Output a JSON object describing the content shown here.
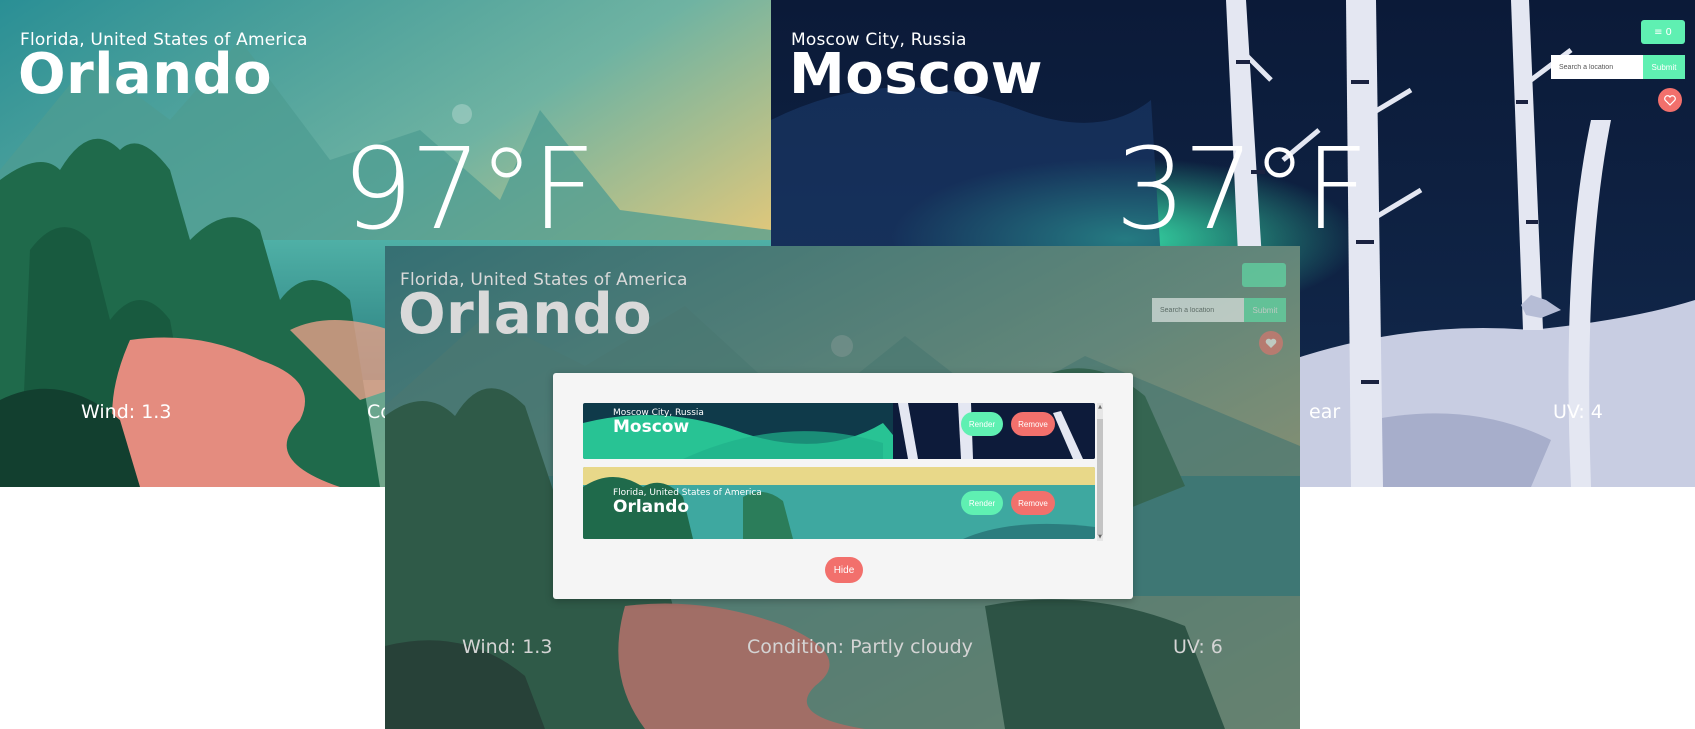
{
  "orlando_bg": {
    "region": "Florida,  United States of America",
    "city": "Orlando",
    "temp": "97°F",
    "wind": "Wind: 1.3",
    "condition_partial": "Co"
  },
  "moscow_bg": {
    "region": "Moscow City,  Russia",
    "city": "Moscow",
    "temp": "37°F",
    "condition_partial": "ear",
    "uv": "UV: 4",
    "fav_count": "0",
    "search_placeholder": "Search a location",
    "submit": "Submit"
  },
  "front": {
    "region": "Florida,  United States of America",
    "city": "Orlando",
    "wind": "Wind: 1.3",
    "condition": "Condition: Partly cloudy",
    "uv": "UV: 6",
    "search_placeholder": "Search a location",
    "submit": "Submit"
  },
  "modal": {
    "saved": [
      {
        "region": "Moscow City, Russia",
        "city": "Moscow",
        "render": "Render",
        "remove": "Remove"
      },
      {
        "region": "Florida, United States of America",
        "city": "Orlando",
        "render": "Render",
        "remove": "Remove"
      }
    ],
    "hide": "Hide"
  },
  "icons": {
    "list": "list-icon",
    "heart": "heart-icon"
  },
  "colors": {
    "accent_green": "#5ff0b2",
    "accent_red": "#f2706c",
    "modal_bg": "#f5f5f5"
  }
}
